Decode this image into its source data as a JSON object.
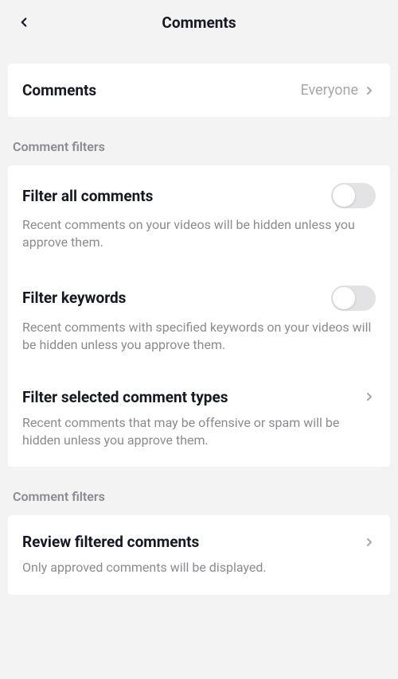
{
  "header": {
    "title": "Comments"
  },
  "main": {
    "comments_row": {
      "label": "Comments",
      "value": "Everyone"
    }
  },
  "filters1": {
    "section_title": "Comment filters",
    "items": [
      {
        "label": "Filter all comments",
        "desc": "Recent comments on your videos will be hidden unless you approve them."
      },
      {
        "label": "Filter keywords",
        "desc": "Recent comments with specified keywords on your videos will be hidden unless you approve them."
      },
      {
        "label": "Filter selected comment types",
        "desc": "Recent comments that may be offensive or spam will be hidden unless you approve them."
      }
    ]
  },
  "filters2": {
    "section_title": "Comment filters",
    "items": [
      {
        "label": "Review filtered comments",
        "desc": "Only approved comments will be displayed."
      }
    ]
  }
}
